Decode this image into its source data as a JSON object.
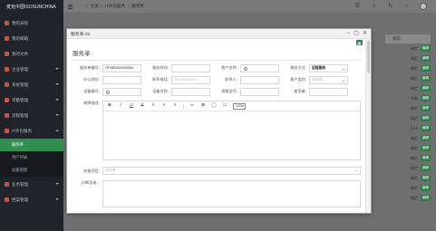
{
  "app": {
    "brand": "麦克中国ISOSUNCHINA"
  },
  "sidebar": {
    "items": [
      {
        "label": "我的日程",
        "has_caret": false
      },
      {
        "label": "我的邮箱",
        "has_caret": false
      },
      {
        "label": "我的文件",
        "has_caret": false
      },
      {
        "label": "企业管理",
        "has_caret": true
      },
      {
        "label": "系统管理",
        "has_caret": true
      },
      {
        "label": "考勤管理",
        "has_caret": true
      },
      {
        "label": "流程管理",
        "has_caret": true
      },
      {
        "label": "IT外包服务",
        "has_caret": true,
        "open": true
      }
    ],
    "subitems": [
      {
        "label": "服务单",
        "active": true
      },
      {
        "label": "用户列表",
        "active": false
      },
      {
        "label": "设备管理",
        "active": false
      }
    ],
    "items_after": [
      {
        "label": "业务管理",
        "has_caret": true
      },
      {
        "label": "档案管理",
        "has_caret": true
      }
    ]
  },
  "header": {
    "breadcrumbs": [
      "主页",
      "IT外包服务",
      "服务单"
    ],
    "separator": "/"
  },
  "background_table": {
    "column_header": "状态",
    "rows": [
      {
        "text": "确定",
        "badge": "编辑"
      },
      {
        "text": "确定",
        "badge": "编辑"
      },
      {
        "text": "确定",
        "badge": "编辑"
      },
      {
        "text": "确定",
        "badge": "编辑"
      },
      {
        "text": "确定",
        "badge": "编辑"
      },
      {
        "text": "未确",
        "badge": "编辑"
      },
      {
        "text": "确定",
        "badge": "编辑"
      },
      {
        "text": "确定",
        "badge": "编辑"
      },
      {
        "text": "针叶",
        "badge": "编辑"
      },
      {
        "text": "确定",
        "badge": "编辑"
      },
      {
        "text": "确定",
        "badge": "编辑"
      },
      {
        "text": "确定",
        "badge": "编辑"
      },
      {
        "text": "确定",
        "badge": "编辑"
      },
      {
        "text": "确定",
        "badge": "编辑"
      },
      {
        "text": "确定",
        "badge": "编辑"
      },
      {
        "text": "确定",
        "badge": "编辑"
      }
    ]
  },
  "modal": {
    "title": "服务单-01",
    "section_title": "服务单",
    "rows": [
      [
        {
          "label": "服务单编号:",
          "value": "ITFWD202006300",
          "type": "text"
        },
        {
          "label": "服务时间:",
          "value": "",
          "type": "text"
        },
        {
          "label": "客户名称:",
          "value": "",
          "type": "search"
        },
        {
          "label": "服务方式:",
          "value": "远程服务",
          "type": "select"
        }
      ],
      [
        {
          "label": "办公地址:",
          "value": "",
          "type": "text"
        },
        {
          "label": "联系电话:",
          "value": "",
          "placeholder": "000-00000000",
          "type": "text"
        },
        {
          "label": "联系人:",
          "value": "",
          "type": "text"
        },
        {
          "label": "客户类别:",
          "value": "",
          "placeholder": "请选择...",
          "type": "select"
        }
      ],
      [
        {
          "label": "设备编号:",
          "value": "",
          "type": "search"
        },
        {
          "label": "设备名称:",
          "value": "",
          "type": "text"
        },
        {
          "label": "规格型号:",
          "value": "",
          "type": "text"
        },
        {
          "label": "使用者:",
          "value": "",
          "type": "text"
        }
      ]
    ],
    "editor": {
      "label": "故障描述:",
      "zoom": "100%"
    },
    "check": {
      "label": "检查项目:",
      "placeholder": "请选择..."
    },
    "diagnosis": {
      "label": "诊断及修..."
    }
  }
}
